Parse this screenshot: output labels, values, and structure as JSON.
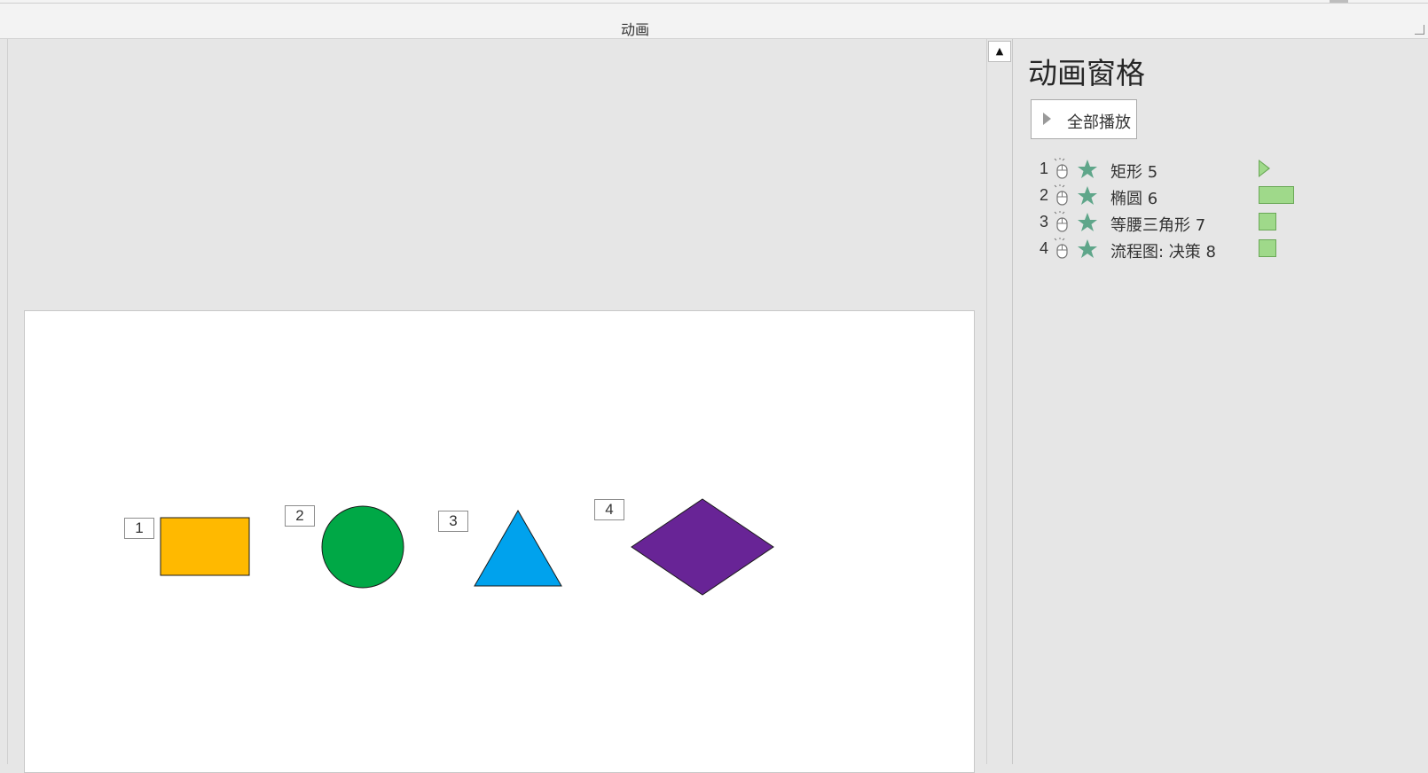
{
  "ribbon": {
    "group_label": "动画"
  },
  "slide": {
    "tags": [
      "1",
      "2",
      "3",
      "4"
    ],
    "shapes": [
      {
        "name": "rectangle",
        "fill": "#FFB900"
      },
      {
        "name": "ellipse",
        "fill": "#00A846"
      },
      {
        "name": "triangle",
        "fill": "#00A2ED"
      },
      {
        "name": "diamond",
        "fill": "#682496"
      }
    ]
  },
  "animation_pane": {
    "title": "动画窗格",
    "play_all_label": "全部播放",
    "items": [
      {
        "index": "1",
        "name": "矩形 5",
        "trigger_icon": "mouse-click-icon",
        "effect_icon": "star-icon",
        "timeline": "start"
      },
      {
        "index": "2",
        "name": "椭圆 6",
        "trigger_icon": "mouse-click-icon",
        "effect_icon": "star-icon",
        "timeline": "bar"
      },
      {
        "index": "3",
        "name": "等腰三角形 7",
        "trigger_icon": "mouse-click-icon",
        "effect_icon": "star-icon",
        "timeline": "bar"
      },
      {
        "index": "4",
        "name": "流程图: 决策 8",
        "trigger_icon": "mouse-click-icon",
        "effect_icon": "star-icon",
        "timeline": "bar"
      }
    ]
  },
  "colors": {
    "star": "#5FA68A",
    "timeline": "#9FD98A"
  }
}
